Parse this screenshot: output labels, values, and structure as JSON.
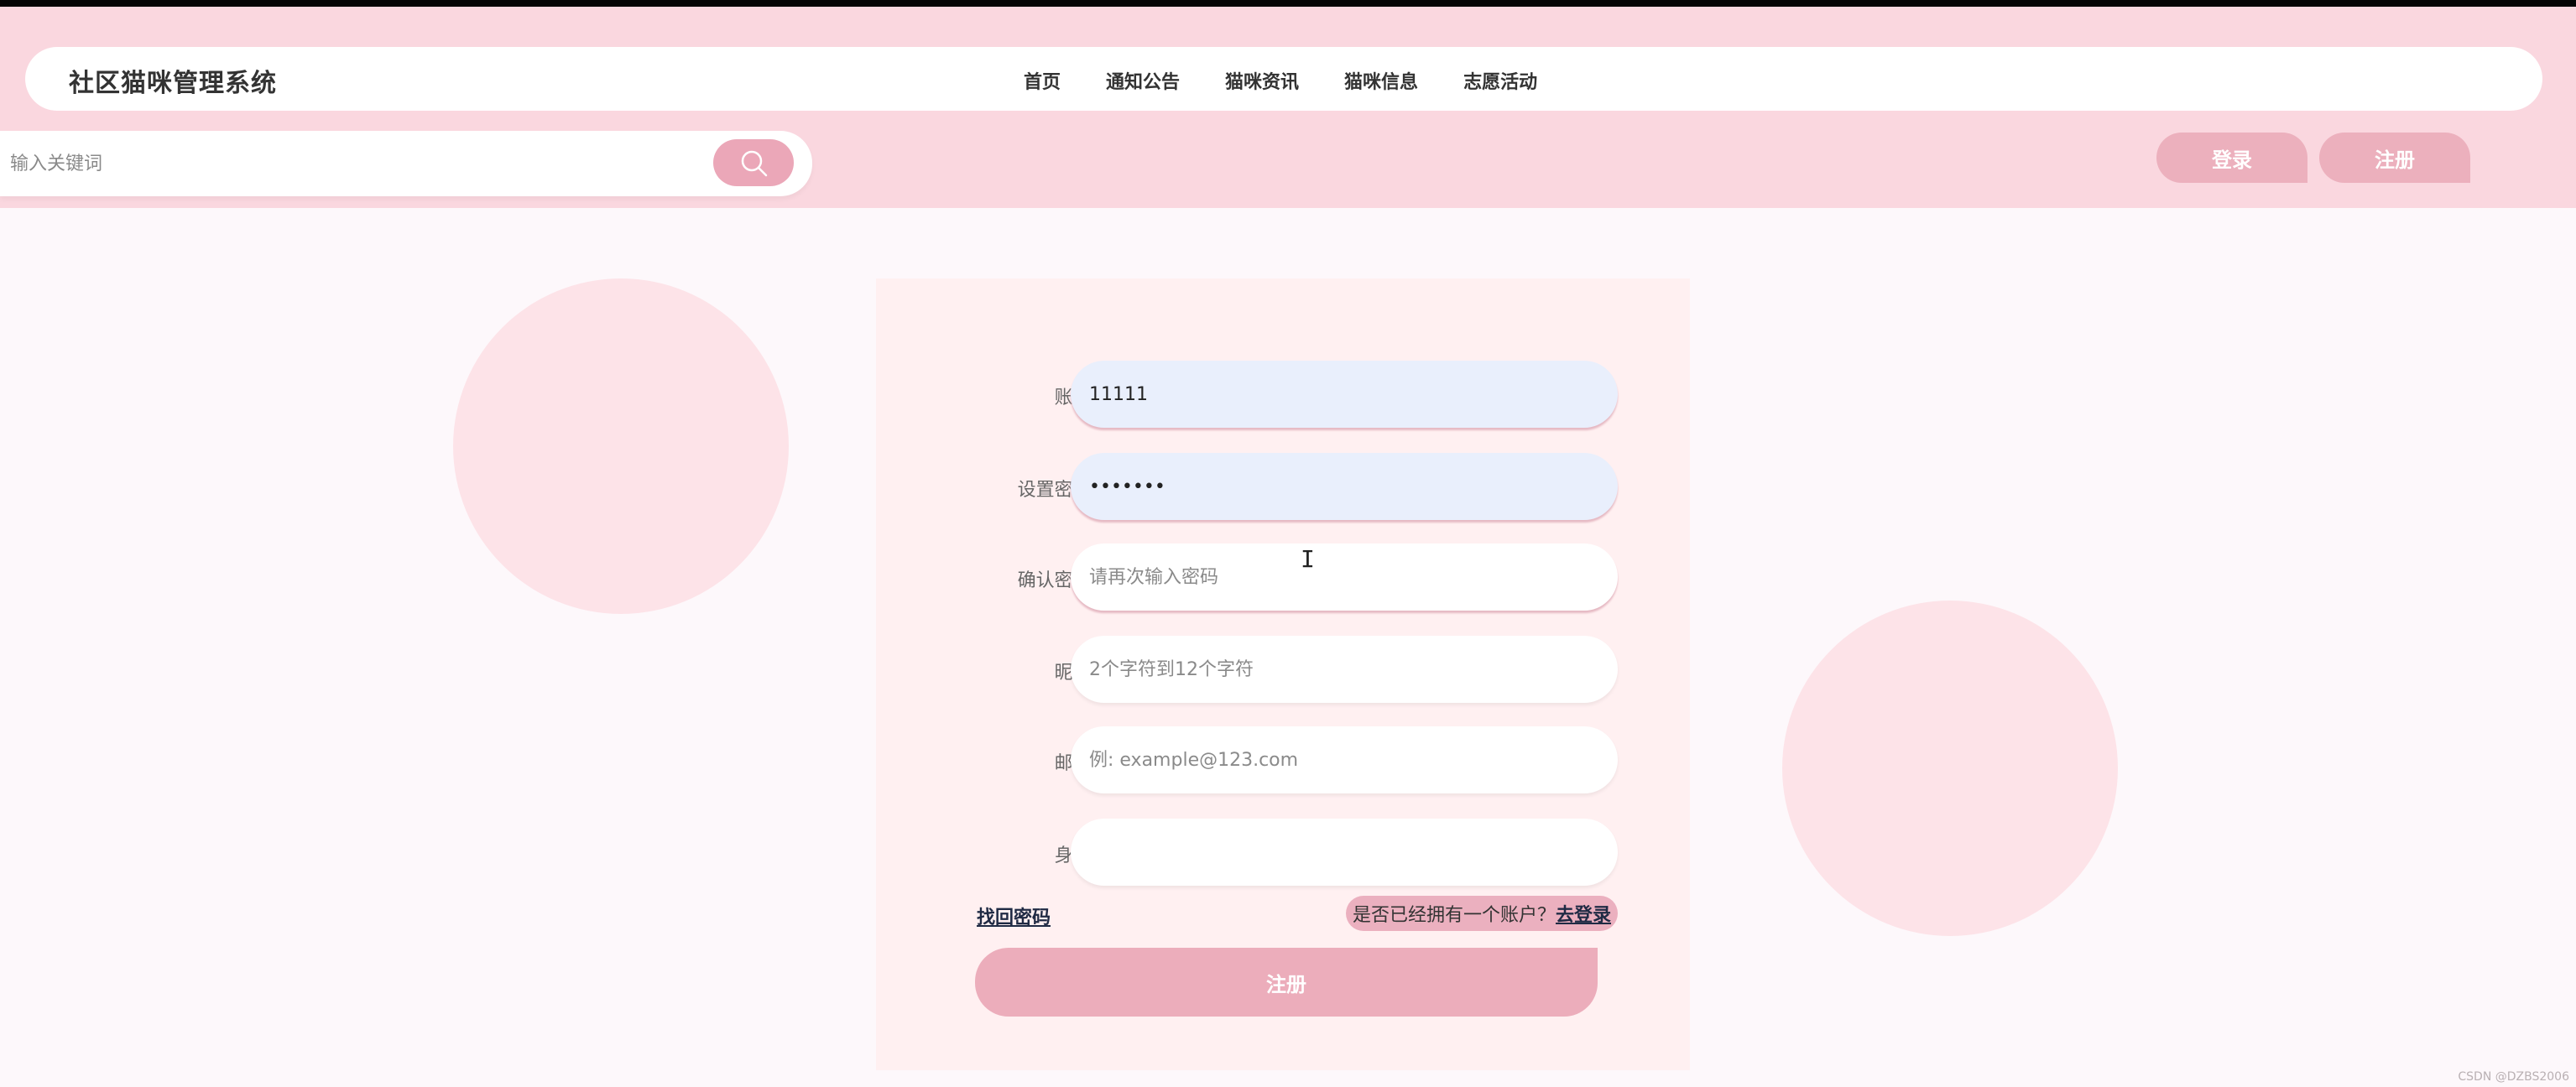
{
  "header": {
    "title": "社区猫咪管理系统",
    "nav": [
      {
        "label": "首页"
      },
      {
        "label": "通知公告"
      },
      {
        "label": "猫咪资讯"
      },
      {
        "label": "猫咪信息"
      },
      {
        "label": "志愿活动"
      }
    ],
    "search": {
      "placeholder": "输入关键词",
      "icon": "search-icon"
    },
    "login_label": "登录",
    "register_label": "注册"
  },
  "form": {
    "fields": [
      {
        "label": "账号:",
        "value": "11111",
        "placeholder": ""
      },
      {
        "label": "设置密码:",
        "value": "•••••••",
        "placeholder": ""
      },
      {
        "label": "确认密码:",
        "value": "",
        "placeholder": "请再次输入密码"
      },
      {
        "label": "昵称:",
        "value": "",
        "placeholder": "2个字符到12个字符"
      },
      {
        "label": "邮箱:",
        "value": "",
        "placeholder": "例: example@123.com"
      },
      {
        "label": "身份:",
        "value": "",
        "placeholder": ""
      }
    ],
    "forgot_label": "找回密码",
    "have_account_text": "是否已经拥有一个账户？",
    "to_login_label": "去登录",
    "submit_label": "注册"
  },
  "watermark": "CSDN @DZBS2006",
  "colors": {
    "header_band": "#fad7df",
    "accent_pink": "#ecadbb",
    "panel": "#fff0f1",
    "filled_field": "#e9effc"
  }
}
